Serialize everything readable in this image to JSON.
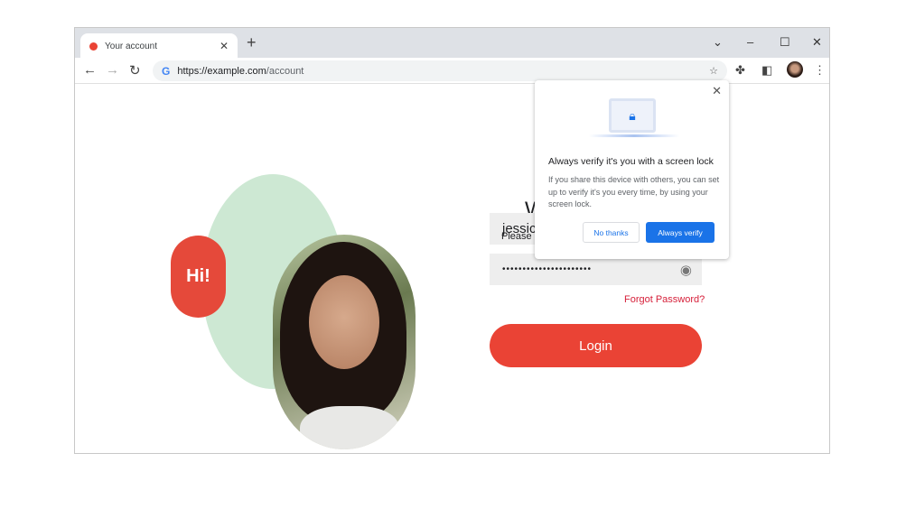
{
  "browser": {
    "tab_title": "Your account",
    "url_host": "https://example.com",
    "url_path": "/account",
    "icons": [
      "close-icon",
      "plus-icon",
      "chevron-down-icon",
      "minimize-icon",
      "maximize-icon",
      "close-icon",
      "back-icon",
      "forward-icon",
      "reload-icon",
      "google-icon",
      "star-icon",
      "extension-icon",
      "side-panel-icon",
      "avatar",
      "more-icon"
    ]
  },
  "page": {
    "greeting_badge": "Hi!",
    "title_visible": "W",
    "subtitle_visible": "Please",
    "username_visible": "jessic",
    "password_masked": "••••••••••••••••••••••",
    "forgot_password": "Forgot Password?",
    "login_label": "Login",
    "colors": {
      "accent": "#ea4335",
      "link": "#d6203a",
      "blob": "#cde8d3"
    }
  },
  "popup": {
    "heading": "Always verify it's you with a screen lock",
    "body": "If you share this device with others, you can set up to verify it's you every time, by using your screen lock.",
    "no_thanks": "No thanks",
    "always_verify": "Always verify",
    "primary_color": "#1a73e8"
  }
}
